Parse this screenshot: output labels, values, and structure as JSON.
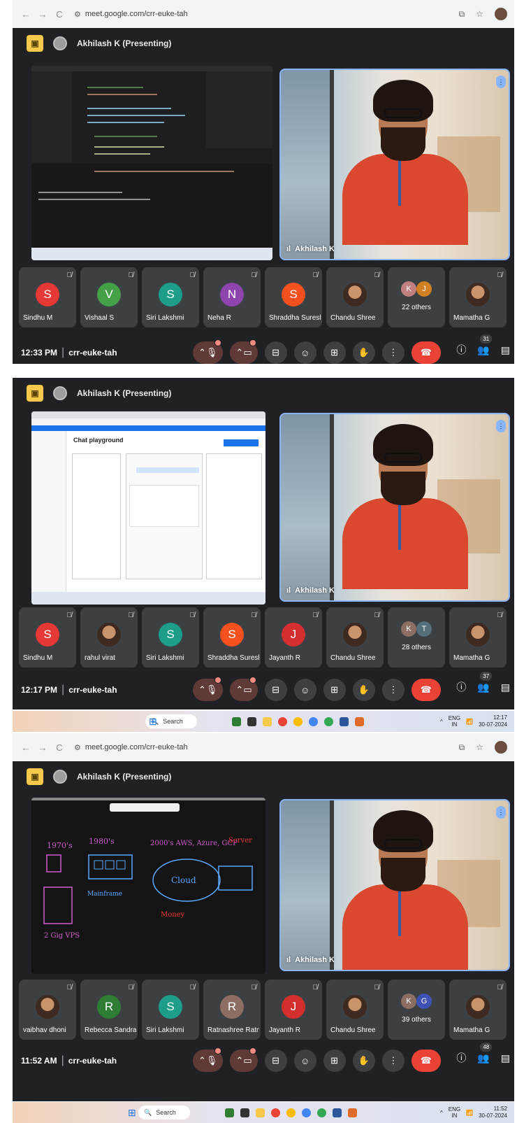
{
  "browser": {
    "url": "meet.google.com/crr-euke-tah",
    "back": "←",
    "forward": "→",
    "reload": "C"
  },
  "meeting_code": "crr-euke-tah",
  "presenter_label": "Akhilash K (Presenting)",
  "speaker_name": "Akhilash K",
  "sections": [
    {
      "time": "12:33 PM",
      "participants_count": "31",
      "tiles": [
        {
          "type": "letter",
          "letter": "S",
          "name": "Sindhu M",
          "color": "#e53935"
        },
        {
          "type": "letter",
          "letter": "V",
          "name": "Vishaal S",
          "color": "#43a047"
        },
        {
          "type": "letter",
          "letter": "S",
          "name": "Siri Lakshmi",
          "color": "#1e9e8a"
        },
        {
          "type": "letter",
          "letter": "N",
          "name": "Neha R",
          "color": "#8e44ad"
        },
        {
          "type": "letter",
          "letter": "S",
          "name": "Shraddha Suresh",
          "color": "#f4511e"
        },
        {
          "type": "photo",
          "letter": "",
          "name": "Chandu Shree",
          "color": ""
        },
        {
          "type": "others",
          "letter": "",
          "name": "22 others",
          "i1": "K",
          "i2": "J",
          "c1": "#c08080",
          "c2": "#d08020"
        },
        {
          "type": "photo",
          "letter": "",
          "name": "Mamatha G",
          "color": ""
        }
      ]
    },
    {
      "time": "12:17 PM",
      "participants_count": "37",
      "tiles": [
        {
          "type": "letter",
          "letter": "S",
          "name": "Sindhu M",
          "color": "#e53935"
        },
        {
          "type": "photo",
          "letter": "",
          "name": "rahul virat",
          "color": ""
        },
        {
          "type": "letter",
          "letter": "S",
          "name": "Siri Lakshmi",
          "color": "#1e9e8a"
        },
        {
          "type": "letter",
          "letter": "S",
          "name": "Shraddha Suresh",
          "color": "#f4511e"
        },
        {
          "type": "letter",
          "letter": "J",
          "name": "Jayanth R",
          "color": "#d32f2f"
        },
        {
          "type": "photo",
          "letter": "",
          "name": "Chandu Shree",
          "color": ""
        },
        {
          "type": "others",
          "letter": "",
          "name": "28 others",
          "i1": "K",
          "i2": "T",
          "c1": "#8d6e63",
          "c2": "#546e7a"
        },
        {
          "type": "photo",
          "letter": "",
          "name": "Mamatha G",
          "color": ""
        }
      ],
      "taskbar": {
        "search": "Search",
        "lang": "ENG",
        "region": "IN",
        "clock_time": "12:17",
        "clock_date": "30-07-2024"
      }
    },
    {
      "time": "11:52 AM",
      "participants_count": "48",
      "tiles": [
        {
          "type": "photo",
          "letter": "",
          "name": "vaibhav dhoni",
          "color": ""
        },
        {
          "type": "letter",
          "letter": "R",
          "name": "Rebecca Sandra",
          "color": "#2e7d32"
        },
        {
          "type": "letter",
          "letter": "S",
          "name": "Siri Lakshmi",
          "color": "#1e9e8a"
        },
        {
          "type": "letter",
          "letter": "R",
          "name": "Ratnashree Ratn...",
          "color": "#8d6e63"
        },
        {
          "type": "letter",
          "letter": "J",
          "name": "Jayanth R",
          "color": "#d32f2f"
        },
        {
          "type": "photo",
          "letter": "",
          "name": "Chandu Shree",
          "color": ""
        },
        {
          "type": "others",
          "letter": "",
          "name": "39 others",
          "i1": "K",
          "i2": "G",
          "c1": "#8d6e63",
          "c2": "#3f51b5"
        },
        {
          "type": "photo",
          "letter": "",
          "name": "Mamatha G",
          "color": ""
        }
      ],
      "taskbar": {
        "search": "Search",
        "lang": "ENG",
        "region": "IN",
        "clock_time": "11:52",
        "clock_date": "30-07-2024"
      }
    }
  ],
  "shared_screen_2": {
    "title": "Chat playground"
  },
  "whiteboard": {
    "labels": [
      "1970's",
      "1980's",
      "2000's AWS, Azure, GCP",
      "Server",
      "Cloud",
      "Mainframe",
      "Money",
      "2 Gig VPS"
    ]
  },
  "icons": {
    "mic": "mic-icon",
    "cam": "camera-icon",
    "captions": "captions-icon",
    "emoji": "emoji-icon",
    "present": "present-icon",
    "hand": "raise-hand-icon",
    "more": "more-icon",
    "leave": "leave-call-icon",
    "info": "info-icon",
    "people": "people-icon",
    "chat": "chat-icon"
  }
}
